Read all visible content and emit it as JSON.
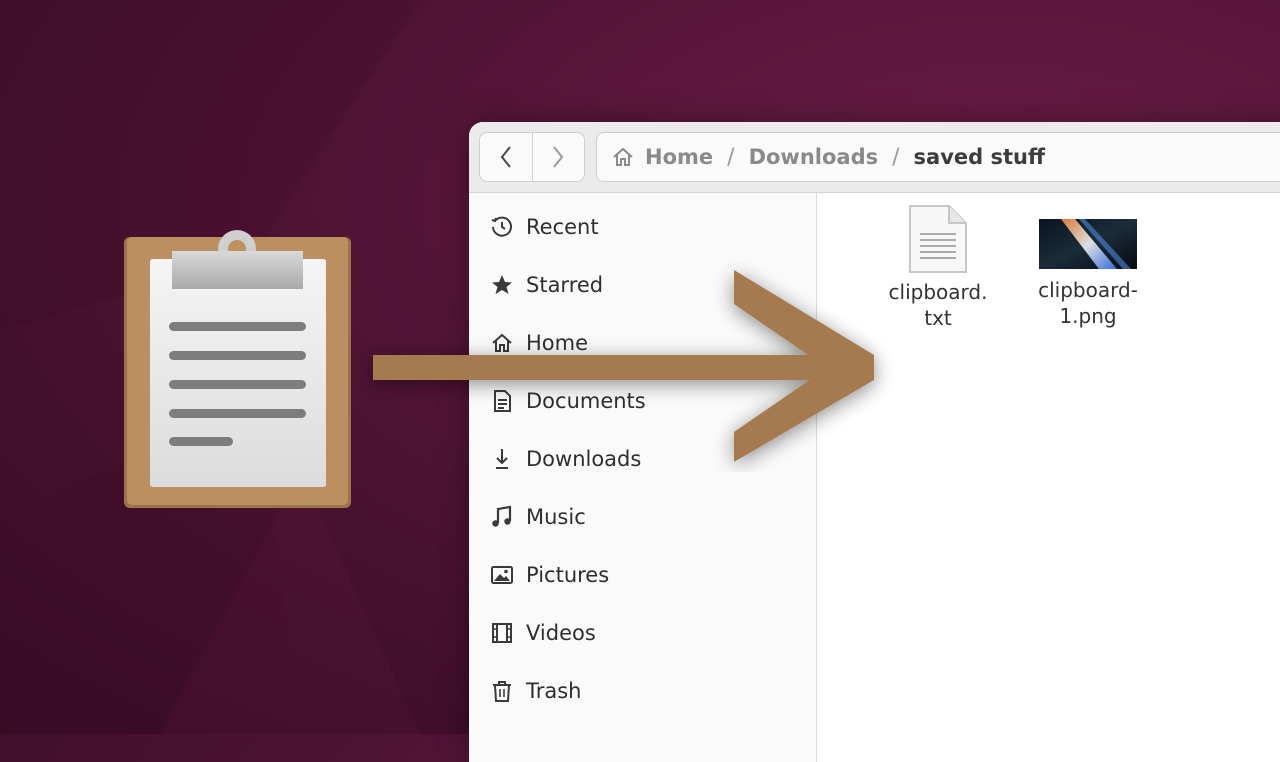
{
  "window": {
    "breadcrumbs": [
      "Home",
      "Downloads",
      "saved stuff"
    ],
    "separator": "/"
  },
  "sidebar": {
    "items": [
      {
        "label": "Recent",
        "icon": "clock-icon"
      },
      {
        "label": "Starred",
        "icon": "star-icon"
      },
      {
        "label": "Home",
        "icon": "home-icon"
      },
      {
        "label": "Documents",
        "icon": "document-icon"
      },
      {
        "label": "Downloads",
        "icon": "download-icon"
      },
      {
        "label": "Music",
        "icon": "music-icon"
      },
      {
        "label": "Pictures",
        "icon": "picture-icon"
      },
      {
        "label": "Videos",
        "icon": "video-icon"
      },
      {
        "label": "Trash",
        "icon": "trash-icon"
      }
    ]
  },
  "files": [
    {
      "name_line1": "clipboard.",
      "name_line2": "txt",
      "type": "text-file-icon"
    },
    {
      "name_line1": "clipboard-",
      "name_line2": "1.png",
      "type": "image-thumbnail"
    }
  ],
  "colors": {
    "background": "#561538",
    "arrow": "#a57a4f",
    "clipboard_board": "#b98c5d"
  }
}
